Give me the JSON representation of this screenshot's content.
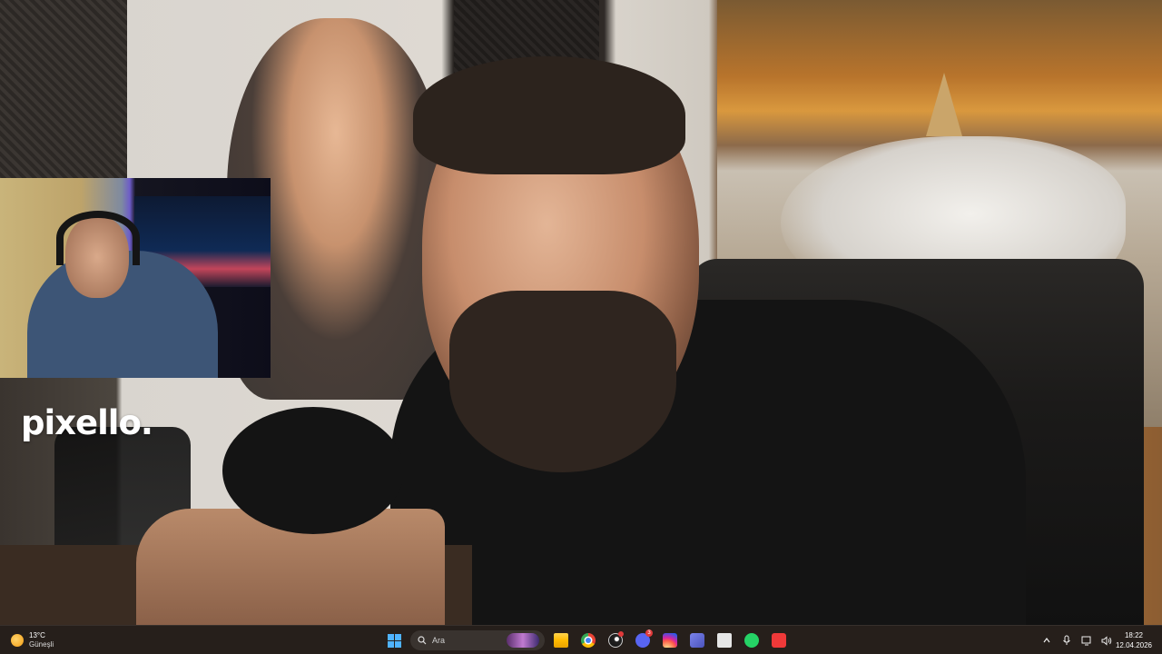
{
  "desktop": {
    "brand_text": "pixello."
  },
  "taskbar": {
    "weather": {
      "temperature": "13°C",
      "condition": "Güneşli",
      "icon": "sun-icon"
    },
    "search": {
      "placeholder": "Ara"
    },
    "pinned_apps": [
      {
        "name": "start",
        "icon": "windows-icon"
      },
      {
        "name": "file-explorer",
        "icon": "folder-icon"
      },
      {
        "name": "chrome",
        "icon": "chrome-icon"
      },
      {
        "name": "steam",
        "icon": "steam-icon"
      },
      {
        "name": "discord",
        "icon": "discord-icon",
        "badge": "3"
      },
      {
        "name": "instagram",
        "icon": "instagram-icon"
      },
      {
        "name": "teams",
        "icon": "teams-icon"
      },
      {
        "name": "calculator",
        "icon": "calculator-icon"
      },
      {
        "name": "whatsapp",
        "icon": "whatsapp-icon"
      },
      {
        "name": "vivaldi",
        "icon": "vivaldi-icon"
      }
    ],
    "tray": [
      "chevron-up-icon",
      "microphone-icon",
      "display-icon",
      "speaker-icon"
    ],
    "clock": {
      "time": "18:22",
      "date": "12.04.2026"
    }
  },
  "colors": {
    "taskbar_bg": "#2a201c",
    "accent": "#4fb3ff"
  }
}
